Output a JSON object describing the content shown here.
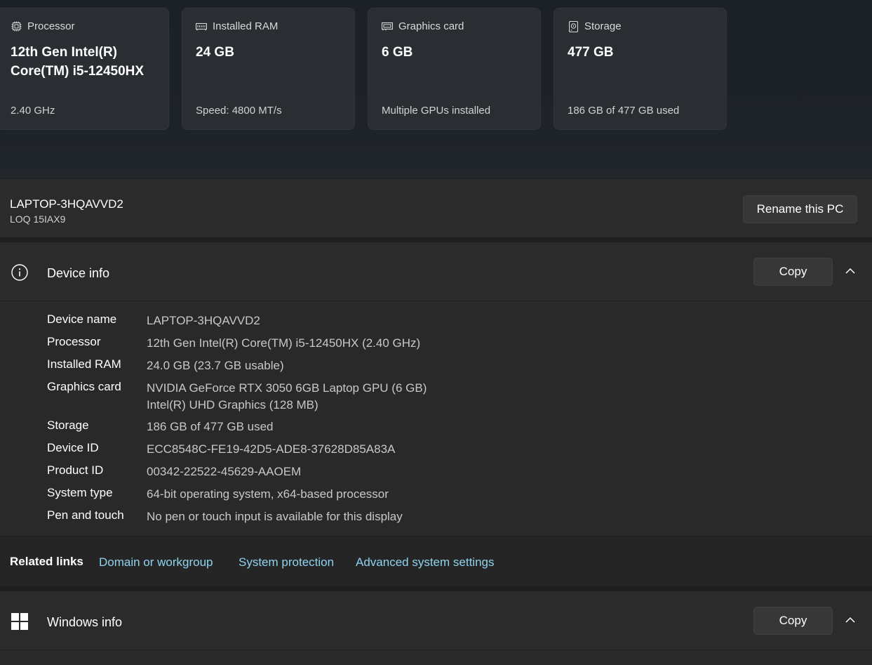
{
  "cards": [
    {
      "title": "Processor",
      "icon": "processor-icon",
      "value": "12th Gen Intel(R) Core(TM) i5-12450HX",
      "sub": "2.40 GHz"
    },
    {
      "title": "Installed RAM",
      "icon": "ram-icon",
      "value": "24 GB",
      "sub": "Speed: 4800 MT/s"
    },
    {
      "title": "Graphics card",
      "icon": "graphics-card-icon",
      "value": "6 GB",
      "sub": "Multiple GPUs installed"
    },
    {
      "title": "Storage",
      "icon": "storage-icon",
      "value": "477 GB",
      "sub": "186 GB of 477 GB used"
    }
  ],
  "pc": {
    "name": "LAPTOP-3HQAVVD2",
    "model": "LOQ 15IAX9",
    "rename_label": "Rename this PC"
  },
  "device_info": {
    "title": "Device info",
    "copy_label": "Copy",
    "rows": [
      {
        "label": "Device name",
        "value": "LAPTOP-3HQAVVD2"
      },
      {
        "label": "Processor",
        "value": "12th Gen Intel(R) Core(TM) i5-12450HX (2.40 GHz)"
      },
      {
        "label": "Installed RAM",
        "value": "24.0 GB (23.7 GB usable)"
      },
      {
        "label": "Graphics card",
        "value": "NVIDIA GeForce RTX 3050 6GB Laptop GPU (6 GB)",
        "value2": "Intel(R) UHD Graphics (128 MB)"
      },
      {
        "label": "Storage",
        "value": "186 GB of 477 GB used"
      },
      {
        "label": "Device ID",
        "value": "ECC8548C-FE19-42D5-ADE8-37628D85A83A"
      },
      {
        "label": "Product ID",
        "value": "00342-22522-45629-AAOEM"
      },
      {
        "label": "System type",
        "value": "64-bit operating system, x64-based processor"
      },
      {
        "label": "Pen and touch",
        "value": "No pen or touch input is available for this display"
      }
    ]
  },
  "related_links": {
    "label": "Related links",
    "links": [
      "Domain or workgroup",
      "System protection",
      "Advanced system settings"
    ]
  },
  "windows_info": {
    "title": "Windows info",
    "copy_label": "Copy"
  },
  "colors": {
    "link": "#8fd3ef",
    "card_bg": "#2a2e33",
    "section_bg": "#2b2b2b"
  }
}
